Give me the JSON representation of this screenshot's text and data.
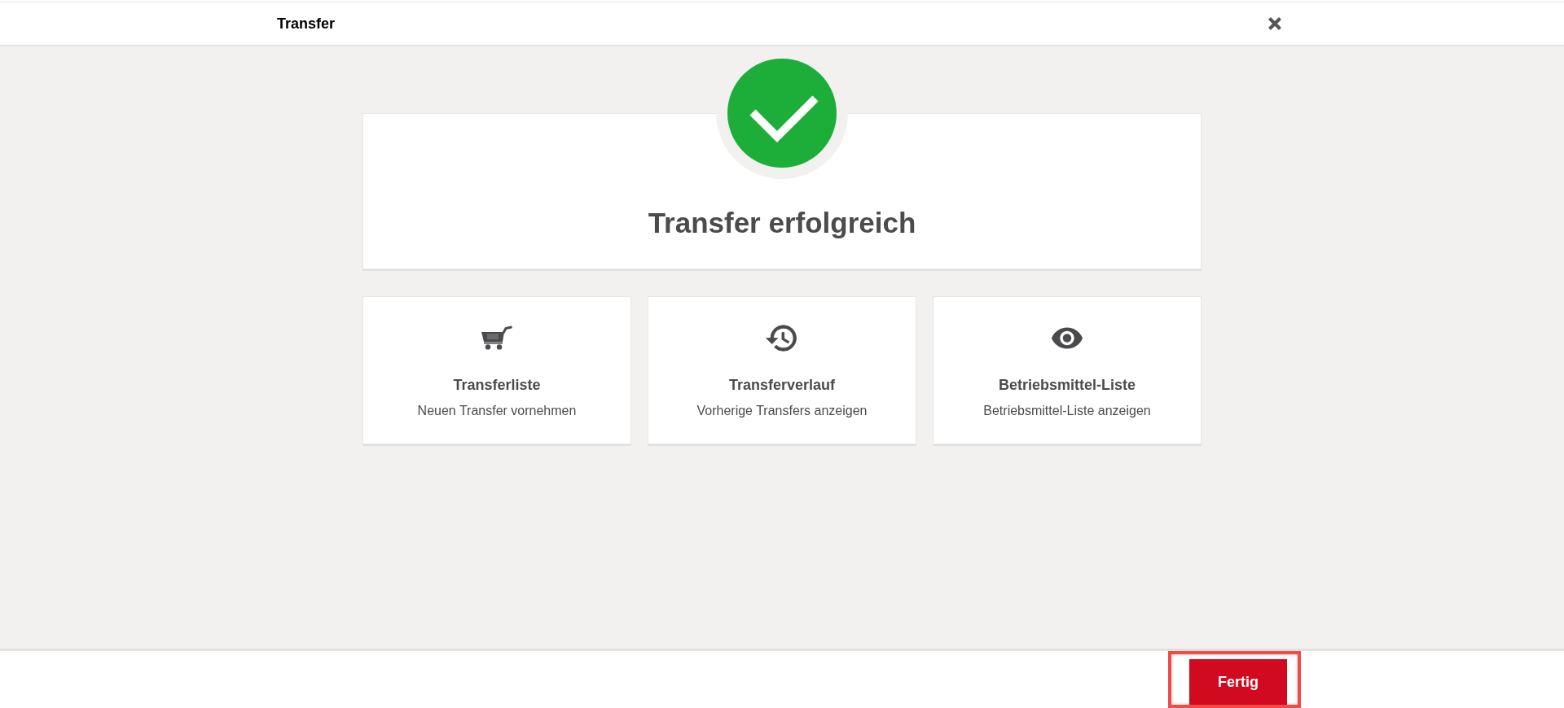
{
  "header": {
    "title": "Transfer"
  },
  "result": {
    "success": true,
    "title": "Transfer erfolgreich"
  },
  "actions": [
    {
      "kind": "cart",
      "title": "Transferliste",
      "subtitle": "Neuen Transfer vornehmen"
    },
    {
      "kind": "history",
      "title": "Transferverlauf",
      "subtitle": "Vorherige Transfers anzeigen"
    },
    {
      "kind": "eye",
      "title": "Betriebsmittel-Liste",
      "subtitle": "Betriebsmittel-Liste anzeigen"
    }
  ],
  "footer": {
    "button": {
      "label": "Fertig",
      "highlighted": true
    }
  }
}
